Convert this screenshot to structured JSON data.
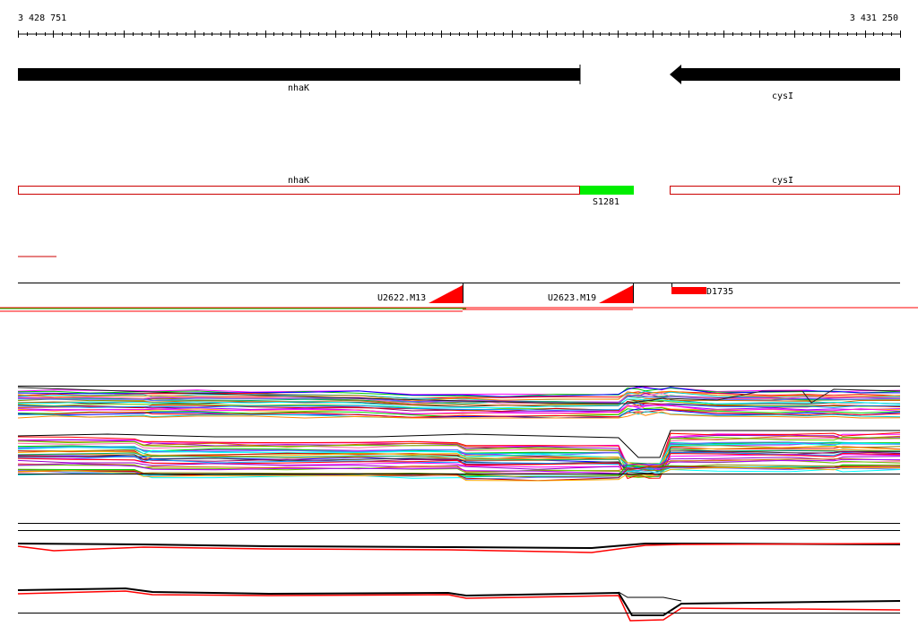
{
  "coordinates": {
    "start_label": "3 428 751",
    "end_label": "3 431 250"
  },
  "genes": [
    {
      "name": "nhaK",
      "strand": "minus"
    },
    {
      "name": "cysI",
      "strand": "minus"
    }
  ],
  "annotations": [
    {
      "name": "nhaK",
      "kind": "gene-box"
    },
    {
      "name": "cysI",
      "kind": "gene-box"
    },
    {
      "name": "S1281",
      "kind": "segment"
    }
  ],
  "features": [
    {
      "name": "U2622.M13"
    },
    {
      "name": "U2623.M19"
    },
    {
      "name": "D1735"
    }
  ],
  "colors": {
    "gene_arrow": "#000000",
    "gene_box_border": "#cc0000",
    "segment": "#00ee00",
    "feature": "#ff0000",
    "track_line": "#000000"
  },
  "palette": [
    "#ff00ff",
    "#00cc00",
    "#0000ff",
    "#ff0000",
    "#00cccc",
    "#ff8800",
    "#9900cc",
    "#888800",
    "#00aa66",
    "#ff66aa",
    "#6666ff",
    "#333333",
    "#cc6600",
    "#00ffff",
    "#990066",
    "#66cc00",
    "#cc0000",
    "#0099ff",
    "#aa00ff",
    "#ffaa00"
  ]
}
